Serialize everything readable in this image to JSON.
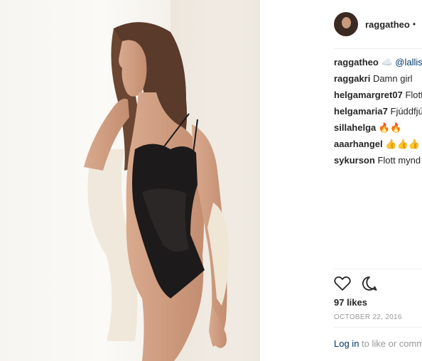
{
  "post": {
    "username": "raggatheo",
    "follow_dot": "•"
  },
  "comments": [
    {
      "user": "raggatheo",
      "text": "☁️ @lallis"
    },
    {
      "user": "raggakri",
      "text": "Damn girl"
    },
    {
      "user": "helgamargret07",
      "text": "Flott"
    },
    {
      "user": "helgamaria7",
      "text": "Fjúddfjú"
    },
    {
      "user": "sillahelga",
      "text": "🔥🔥"
    },
    {
      "user": "aaarhangel",
      "text": "👍👍👍"
    },
    {
      "user": "sykurson",
      "text": "Flott mynd"
    }
  ],
  "icons": {
    "like": "heart-icon",
    "comment": "comment-icon"
  },
  "stats": {
    "likes": "97 likes",
    "date": "OCTOBER 22, 2016"
  },
  "login": {
    "link": "Log in",
    "rest": "to like or comm"
  }
}
